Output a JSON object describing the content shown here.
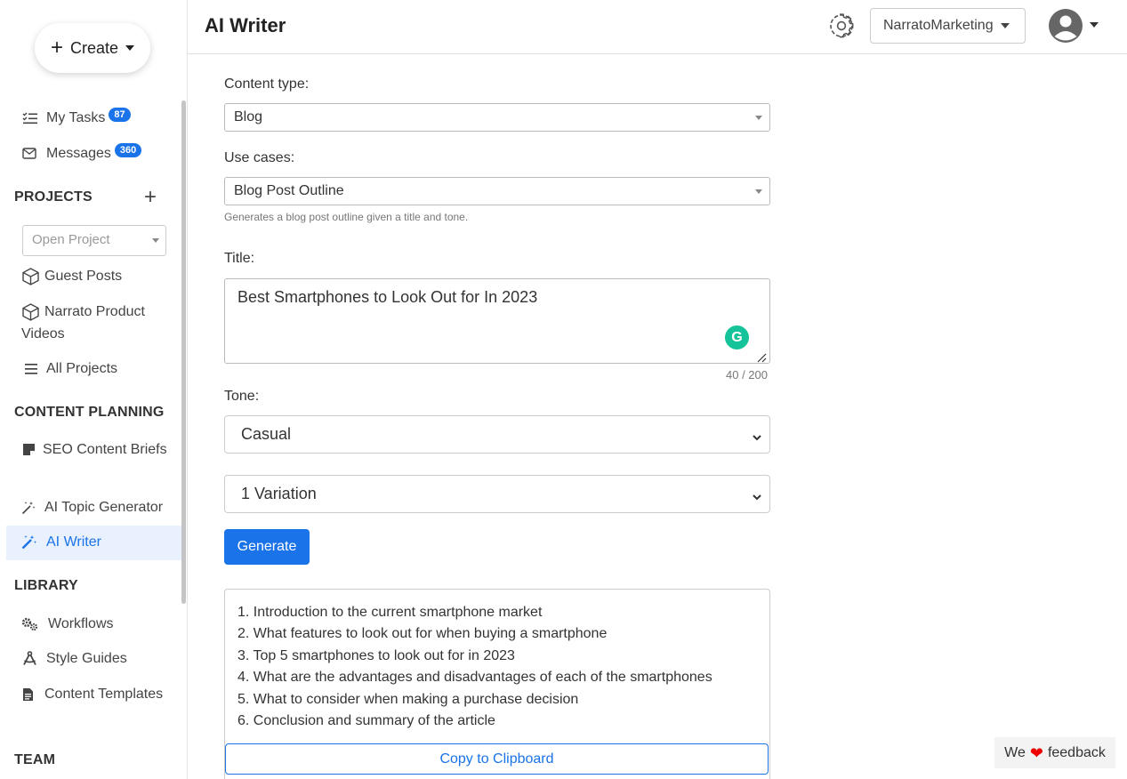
{
  "sidebar": {
    "create_label": "Create",
    "my_tasks": {
      "label": "My Tasks",
      "count": "87"
    },
    "messages": {
      "label": "Messages",
      "count": "360"
    },
    "projects_heading": "PROJECTS",
    "open_project_placeholder": "Open Project",
    "projects": [
      {
        "label": "Guest Posts"
      },
      {
        "label": "Narrato Product Videos"
      }
    ],
    "all_projects": "All Projects",
    "content_planning_heading": "CONTENT PLANNING",
    "planning_items": [
      {
        "label": "SEO Content Briefs"
      },
      {
        "label": "AI Topic Generator"
      },
      {
        "label": "AI Writer"
      }
    ],
    "library_heading": "LIBRARY",
    "library_items": [
      {
        "label": "Workflows"
      },
      {
        "label": "Style Guides"
      },
      {
        "label": "Content Templates"
      }
    ],
    "team_heading": "TEAM"
  },
  "header": {
    "title": "AI Writer",
    "workspace": "NarratoMarketing"
  },
  "form": {
    "content_type_label": "Content type:",
    "content_type_value": "Blog",
    "use_cases_label": "Use cases:",
    "use_case_value": "Blog Post Outline",
    "use_case_help": "Generates a blog post outline given a title and tone.",
    "title_label": "Title:",
    "title_value": "Best Smartphones to Look Out for In 2023",
    "char_count": "40 / 200",
    "tone_label": "Tone:",
    "tone_value": "Casual",
    "variations_value": "1 Variation",
    "generate_label": "Generate"
  },
  "result": {
    "lines": [
      "1. Introduction to the current smartphone market",
      "2. What features to look out for when buying a smartphone",
      "3. Top 5 smartphones to look out for in 2023",
      "4. What are the advantages and disadvantages of each of the smartphones",
      "5. What to consider when making a purchase decision",
      "6. Conclusion and summary of the article"
    ],
    "copy_label": "Copy to Clipboard"
  },
  "feedback": {
    "before": "We",
    "after": "feedback"
  },
  "colors": {
    "accent": "#1a73e8",
    "active_bg": "#e8f1fd",
    "grammarly": "#15c39a"
  }
}
